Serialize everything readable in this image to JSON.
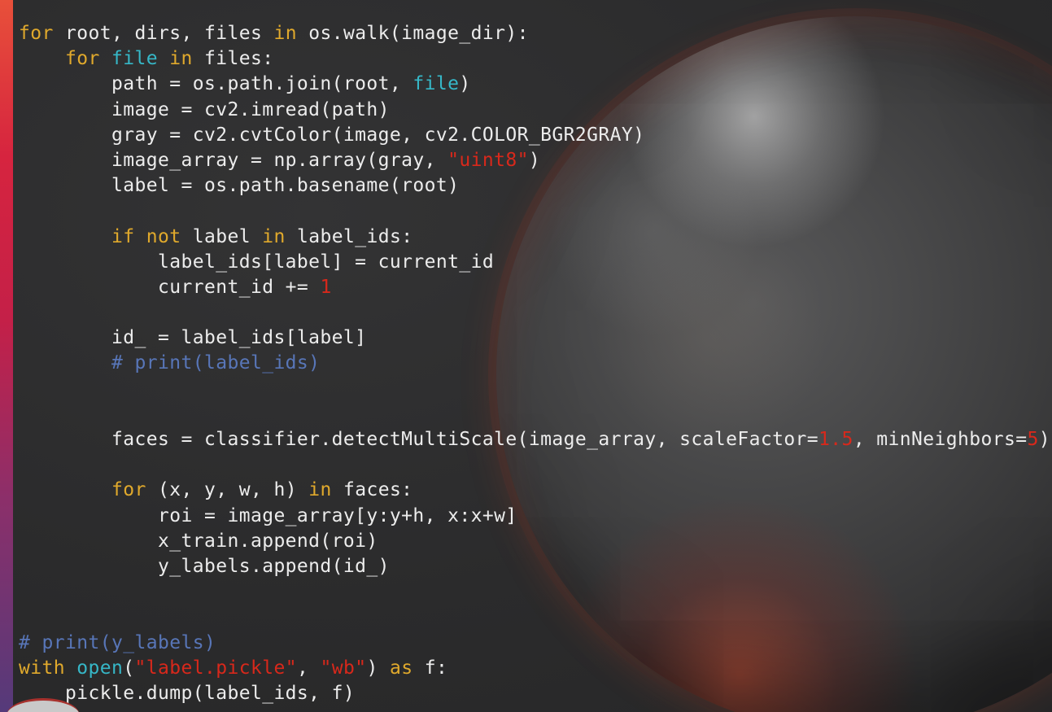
{
  "colors": {
    "keyword": "#e0a92c",
    "builtin": "#36b7c7",
    "string": "#d8281b",
    "comment": "#5876b8",
    "text": "#ececec",
    "background": "#2c2c2d"
  },
  "code": {
    "lines": [
      [
        {
          "t": "for",
          "c": "kw"
        },
        {
          "t": " root, dirs, files "
        },
        {
          "t": "in",
          "c": "kw"
        },
        {
          "t": " os.walk(image_dir):"
        }
      ],
      [
        {
          "t": "    "
        },
        {
          "t": "for",
          "c": "kw"
        },
        {
          "t": " "
        },
        {
          "t": "file",
          "c": "bi"
        },
        {
          "t": " "
        },
        {
          "t": "in",
          "c": "kw"
        },
        {
          "t": " files:"
        }
      ],
      [
        {
          "t": "        path = os.path.join(root, "
        },
        {
          "t": "file",
          "c": "bi"
        },
        {
          "t": ")"
        }
      ],
      [
        {
          "t": "        image = cv2.imread(path)"
        }
      ],
      [
        {
          "t": "        gray = cv2.cvtColor(image, cv2.COLOR_BGR2GRAY)"
        }
      ],
      [
        {
          "t": "        image_array = np.array(gray, "
        },
        {
          "t": "\"uint8\"",
          "c": "str"
        },
        {
          "t": ")"
        }
      ],
      [
        {
          "t": "        label = os.path.basename(root)"
        }
      ],
      [],
      [
        {
          "t": "        "
        },
        {
          "t": "if",
          "c": "kw"
        },
        {
          "t": " "
        },
        {
          "t": "not",
          "c": "kw"
        },
        {
          "t": " label "
        },
        {
          "t": "in",
          "c": "kw"
        },
        {
          "t": " label_ids:"
        }
      ],
      [
        {
          "t": "            label_ids[label] = current_id"
        }
      ],
      [
        {
          "t": "            current_id += "
        },
        {
          "t": "1",
          "c": "num"
        }
      ],
      [],
      [
        {
          "t": "        id_ = label_ids[label]"
        }
      ],
      [
        {
          "t": "        # print(label_ids)",
          "c": "com"
        }
      ],
      [],
      [],
      [
        {
          "t": "        faces = classifier.detectMultiScale(image_array, scaleFactor="
        },
        {
          "t": "1.5",
          "c": "num"
        },
        {
          "t": ", minNeighbors="
        },
        {
          "t": "5",
          "c": "num"
        },
        {
          "t": ")"
        }
      ],
      [],
      [
        {
          "t": "        "
        },
        {
          "t": "for",
          "c": "kw"
        },
        {
          "t": " (x, y, w, h) "
        },
        {
          "t": "in",
          "c": "kw"
        },
        {
          "t": " faces:"
        }
      ],
      [
        {
          "t": "            roi = image_array[y:y+h, x:x+w]"
        }
      ],
      [
        {
          "t": "            x_train.append(roi)"
        }
      ],
      [
        {
          "t": "            y_labels.append(id_)"
        }
      ],
      [],
      [],
      [
        {
          "t": "# print(y_labels)",
          "c": "com"
        }
      ],
      [
        {
          "t": "with",
          "c": "kw"
        },
        {
          "t": " "
        },
        {
          "t": "open",
          "c": "bi"
        },
        {
          "t": "("
        },
        {
          "t": "\"label.pickle\"",
          "c": "str"
        },
        {
          "t": ", "
        },
        {
          "t": "\"wb\"",
          "c": "str"
        },
        {
          "t": ") "
        },
        {
          "t": "as",
          "c": "kw"
        },
        {
          "t": " f:"
        }
      ],
      [
        {
          "t": "    pickle.dump(label_ids, f)"
        }
      ]
    ]
  }
}
